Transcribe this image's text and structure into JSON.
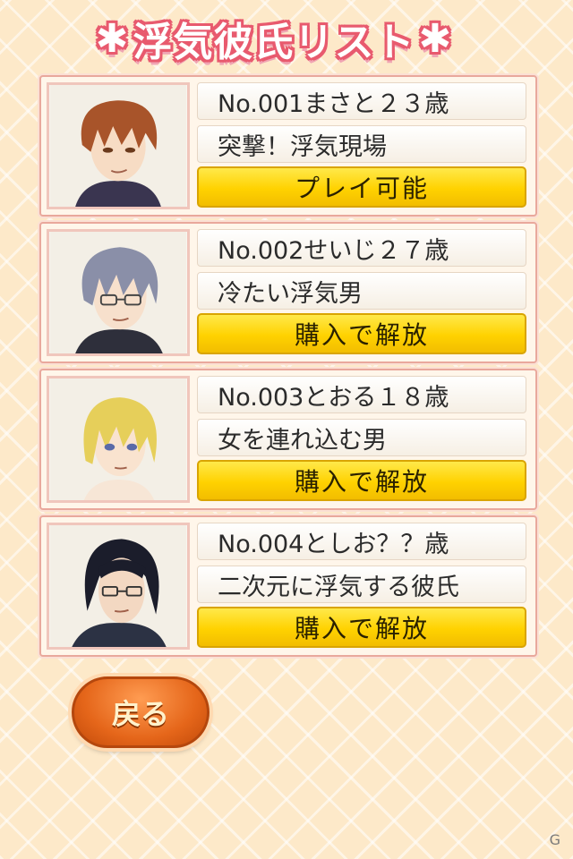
{
  "header": {
    "title": "浮気彼氏リスト",
    "decor_left": "✱",
    "decor_right": "✱"
  },
  "boyfriends": [
    {
      "line1": "No.001まさと２３歳",
      "line2": "突撃！浮気現場",
      "action": "プレイ可能",
      "hair_color": "#a8542a",
      "skin_color": "#f7dcc4"
    },
    {
      "line1": "No.002せいじ２７歳",
      "line2": "冷たい浮気男",
      "action": "購入で解放",
      "hair_color": "#8a8fa8",
      "skin_color": "#f7e0cc"
    },
    {
      "line1": "No.003とおる１８歳",
      "line2": "女を連れ込む男",
      "action": "購入で解放",
      "hair_color": "#e6cf5a",
      "skin_color": "#f9e3cf"
    },
    {
      "line1": "No.004としお？？歳",
      "line2": "二次元に浮気する彼氏",
      "action": "購入で解放",
      "hair_color": "#1b1d2b",
      "skin_color": "#f3d8c2"
    }
  ],
  "footer": {
    "back_label": "戻る",
    "watermark": "G"
  },
  "colors": {
    "accent_pink": "#e85a6e",
    "button_yellow": "#ffd200",
    "back_orange": "#e5661a"
  }
}
